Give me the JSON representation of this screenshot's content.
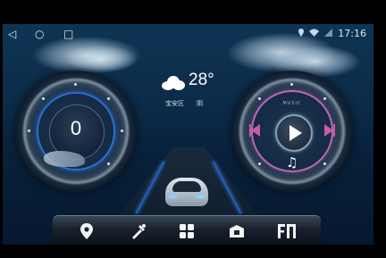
{
  "status_bar": {
    "back_glyph": "◁",
    "home_glyph": "○",
    "recents_glyph": "□",
    "time": "17:16",
    "icons": [
      "location-icon",
      "wifi-icon",
      "signal-icon"
    ]
  },
  "weather": {
    "temperature": "28°",
    "district": "宝安区",
    "condition": "阴",
    "icon": "cloudy-icon"
  },
  "speedometer": {
    "speed": "0"
  },
  "music_player": {
    "label": "MUSIC",
    "controls": [
      "previous-icon",
      "play-icon",
      "next-icon",
      "music-note-icon"
    ]
  },
  "dock": {
    "items": [
      {
        "name": "navigation",
        "icon": "map-pin-icon"
      },
      {
        "name": "tools",
        "icon": "brush-wrench-icon"
      },
      {
        "name": "apps",
        "icon": "grid-icon"
      },
      {
        "name": "car-settings",
        "icon": "radio-box-icon"
      },
      {
        "name": "radio",
        "icon": "fm-icon"
      }
    ]
  },
  "colors": {
    "accent_blue": "#2a6fd1",
    "music_accent": "#c85aa8",
    "background": "#0b2a47"
  }
}
